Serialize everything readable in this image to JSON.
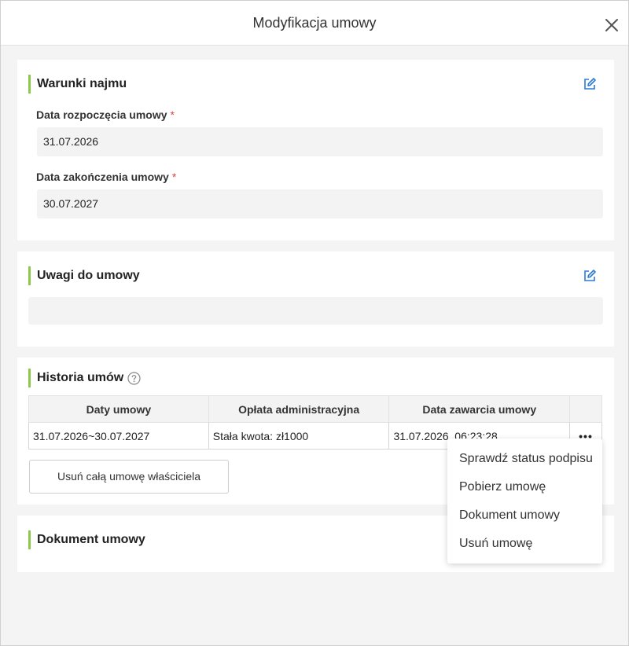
{
  "modal": {
    "title": "Modyfikacja umowy"
  },
  "lease_terms": {
    "title": "Warunki najmu",
    "start_label": "Data rozpoczęcia umowy",
    "start_value": "31.07.2026",
    "end_label": "Data zakończenia umowy",
    "end_value": "30.07.2027",
    "required_mark": "*"
  },
  "notes": {
    "title": "Uwagi do umowy",
    "value": ""
  },
  "history": {
    "title": "Historia umów",
    "columns": [
      "Daty umowy",
      "Opłata administracyjna",
      "Data zawarcia umowy",
      ""
    ],
    "rows": [
      {
        "dates": "31.07.2026~30.07.2027",
        "fee": "Stała kwota: zł1000",
        "signed": "31.07.2026, 06:23:28",
        "more": "•••"
      }
    ],
    "delete_all_label": "Usuń całą umowę właściciela"
  },
  "document": {
    "title": "Dokument umowy"
  },
  "dropdown": {
    "items": [
      "Sprawdź status podpisu",
      "Pobierz umowę",
      "Dokument umowy",
      "Usuń umowę"
    ]
  },
  "colors": {
    "accent": "#8cc84b",
    "edit_icon": "#2b7bd6",
    "required": "#e0453a"
  }
}
